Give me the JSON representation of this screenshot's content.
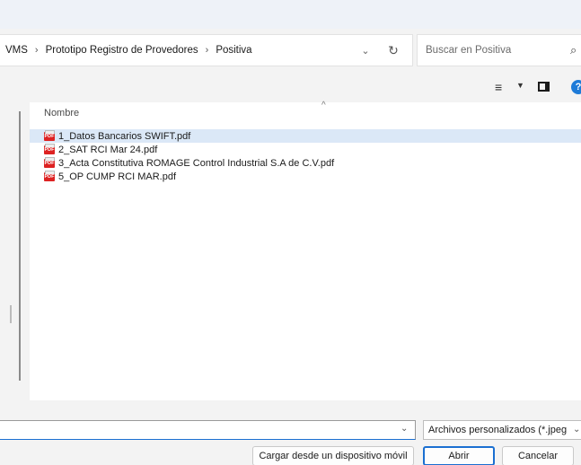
{
  "breadcrumb": {
    "items": [
      "VMS",
      "Prototipo Registro de Provedores",
      "Positiva"
    ]
  },
  "search": {
    "placeholder": "Buscar en Positiva"
  },
  "filelist": {
    "column_name": "Nombre",
    "files": [
      "1_Datos Bancarios SWIFT.pdf",
      "2_SAT RCI Mar 24.pdf",
      "3_Acta Constitutiva ROMAGE Control Industrial S.A de C.V.pdf",
      "5_OP CUMP RCI MAR.pdf"
    ],
    "selected_index": 0,
    "file_icon": "pdf-icon",
    "file_icon_text": "PDF"
  },
  "footer": {
    "filename_value": "",
    "filter_value": "Archivos personalizados (*.jpeg",
    "buttons": {
      "mobile": "Cargar desde un dispositivo móvil",
      "open": "Abrir",
      "cancel": "Cancelar"
    }
  },
  "colors": {
    "accent": "#1a6fd1",
    "selected_row": "#dbe8f7",
    "pdf": "#dd2222"
  }
}
